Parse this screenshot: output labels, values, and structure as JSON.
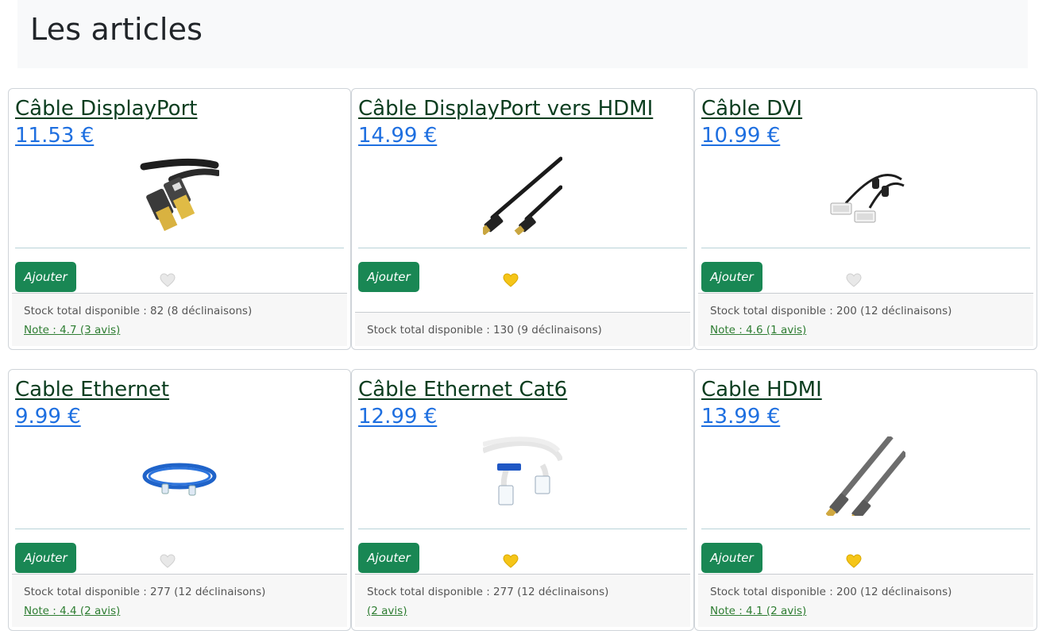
{
  "page": {
    "title": "Les articles"
  },
  "colors": {
    "heart_active": "#f5c518",
    "heart_inactive": "#e8e8e8",
    "button": "#198754",
    "price": "#1e6fe0"
  },
  "products": [
    {
      "title": "Câble DisplayPort",
      "price": "11.53 €",
      "add_label": "Ajouter",
      "favorite": false,
      "stock": "Stock total disponible : 82 (8 déclinaisons)",
      "note": "Note : 4.7 (3 avis)",
      "image_icon": "displayport-cable-image"
    },
    {
      "title": "Câble DisplayPort vers HDMI",
      "price": "14.99 €",
      "add_label": "Ajouter",
      "favorite": true,
      "stock": "Stock total disponible : 130 (9 déclinaisons)",
      "note": "",
      "image_icon": "displayport-hdmi-cable-image"
    },
    {
      "title": "Câble DVI",
      "price": "10.99 €",
      "add_label": "Ajouter",
      "favorite": false,
      "stock": "Stock total disponible : 200 (12 déclinaisons)",
      "note": "Note : 4.6 (1 avis)",
      "image_icon": "dvi-cable-image"
    },
    {
      "title": "Cable Ethernet",
      "price": "9.99 €",
      "add_label": "Ajouter",
      "favorite": false,
      "stock": "Stock total disponible : 277 (12 déclinaisons)",
      "note": "Note : 4.4 (2 avis)",
      "image_icon": "ethernet-cable-image"
    },
    {
      "title": "Câble Ethernet Cat6",
      "price": "12.99 €",
      "add_label": "Ajouter",
      "favorite": true,
      "stock": "Stock total disponible : 277 (12 déclinaisons)",
      "note": "(2 avis)",
      "image_icon": "ethernet-cat6-cable-image"
    },
    {
      "title": "Cable HDMI",
      "price": "13.99 €",
      "add_label": "Ajouter",
      "favorite": true,
      "stock": "Stock total disponible : 200 (12 déclinaisons)",
      "note": "Note : 4.1 (2 avis)",
      "image_icon": "hdmi-cable-image"
    }
  ]
}
